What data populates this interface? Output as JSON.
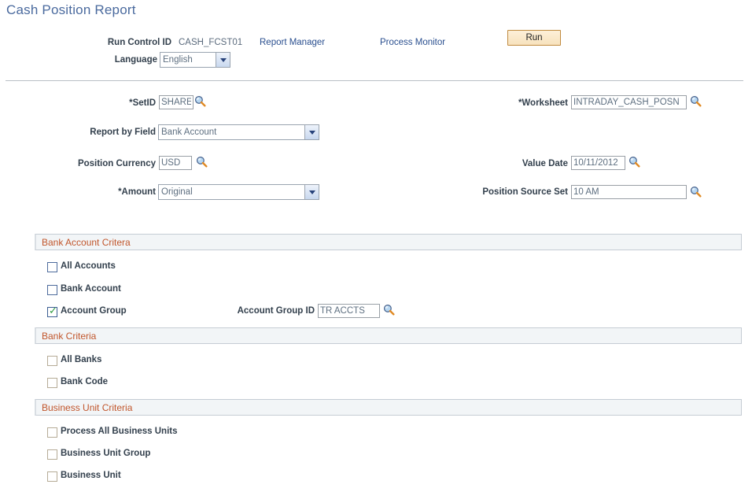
{
  "page": {
    "title": "Cash Position Report",
    "title_color": "#4a6a9e"
  },
  "toolbar": {
    "run_control_label": "Run Control ID",
    "run_control_value": "CASH_FCST01",
    "language_label": "Language",
    "language_value": "English",
    "report_manager_link": "Report Manager",
    "process_monitor_link": "Process Monitor",
    "run_button": "Run",
    "run_button_border": "#c08a3e",
    "run_button_fill": "#f7e2bd"
  },
  "form": {
    "setid": {
      "label": "*SetID",
      "value": "SHARE",
      "lookup": "lookup-icon"
    },
    "worksheet": {
      "label": "*Worksheet",
      "value": "INTRADAY_CASH_POSN",
      "lookup": "lookup-icon"
    },
    "report_by_field": {
      "label": "Report by Field",
      "value": "Bank Account"
    },
    "position_currency": {
      "label": "Position Currency",
      "value": "USD",
      "lookup": "lookup-icon"
    },
    "value_date": {
      "label": "Value Date",
      "value": "10/11/2012",
      "lookup": "lookup-icon"
    },
    "amount": {
      "label": "*Amount",
      "value": "Original"
    },
    "position_source_set": {
      "label": "Position Source Set",
      "value": "10 AM",
      "lookup": "lookup-icon"
    }
  },
  "sections": [
    {
      "title": "Bank Account Critera",
      "checkboxes": [
        {
          "label": "All Accounts",
          "checked": false,
          "style": "blue"
        },
        {
          "label": "Bank Account",
          "checked": false,
          "style": "blue"
        },
        {
          "label": "Account Group",
          "checked": true,
          "style": "blue"
        }
      ],
      "inline_field": {
        "label": "Account Group ID",
        "value": "TR ACCTS",
        "lookup": "lookup-icon"
      }
    },
    {
      "title": "Bank Criteria",
      "checkboxes": [
        {
          "label": "All Banks",
          "checked": false,
          "style": "tan"
        },
        {
          "label": "Bank Code",
          "checked": false,
          "style": "tan"
        }
      ]
    },
    {
      "title": "Business Unit Criteria",
      "checkboxes": [
        {
          "label": "Process All Business Units",
          "checked": false,
          "style": "tan"
        },
        {
          "label": "Business Unit Group",
          "checked": false,
          "style": "tan"
        },
        {
          "label": "Business Unit",
          "checked": false,
          "style": "tan"
        }
      ]
    }
  ],
  "colors": {
    "section_header_text": "#c1562c",
    "section_header_bg": "#f2f5f7",
    "link": "#2a4f8f",
    "label": "#33404d",
    "value": "#5e6f80",
    "check_green": "#2e9b3f"
  },
  "icons": {
    "lookup": "magnifying-glass",
    "dropdown": "chevron-down"
  }
}
